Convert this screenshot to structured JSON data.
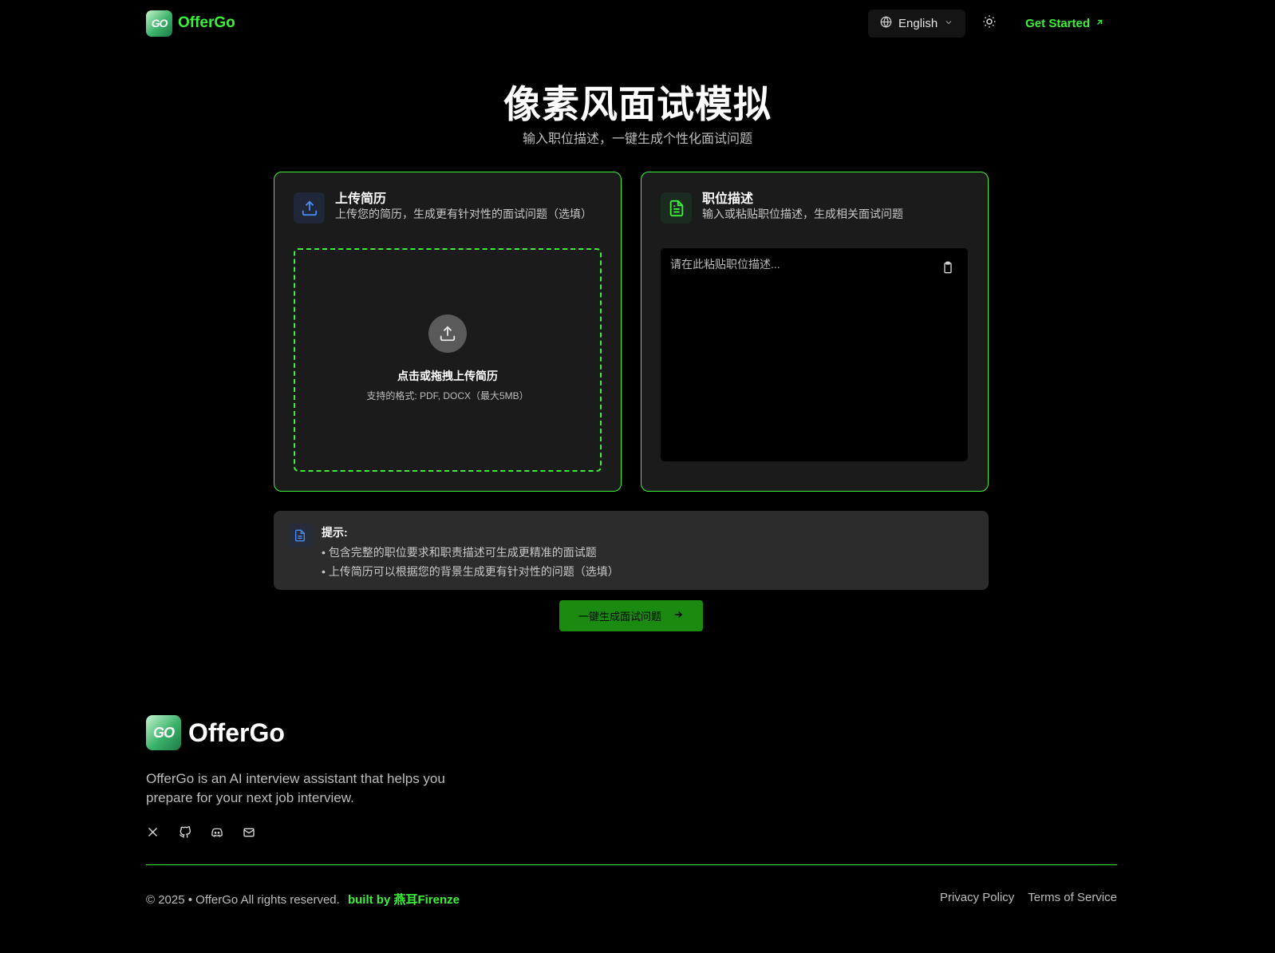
{
  "header": {
    "logo_text": "GO",
    "brand": "OfferGo",
    "language": "English",
    "cta": "Get Started"
  },
  "hero": {
    "title": "像素风面试模拟",
    "subtitle": "输入职位描述，一键生成个性化面试问题"
  },
  "resume_card": {
    "title": "上传简历",
    "description": "上传您的简历，生成更有针对性的面试问题（选填）",
    "upload_title": "点击或拖拽上传简历",
    "upload_hint": "支持的格式: PDF, DOCX（最大5MB）"
  },
  "job_card": {
    "title": "职位描述",
    "description": "输入或粘贴职位描述，生成相关面试问题",
    "placeholder": "请在此粘贴职位描述...",
    "value": ""
  },
  "tips": {
    "title": "提示:",
    "items": [
      "• 包含完整的职位要求和职责描述可生成更精准的面试题",
      "• 上传简历可以根据您的背景生成更有针对性的问题（选填）"
    ]
  },
  "generate_button": "一键生成面试问题",
  "footer": {
    "logo_text": "GO",
    "brand": "OfferGo",
    "description": "OfferGo is an AI interview assistant that helps you prepare for your next job interview.",
    "copyright": "© 2025 • OfferGo All rights reserved.",
    "built_by": "built by 燕耳Firenze",
    "links": [
      "Privacy Policy",
      "Terms of Service"
    ],
    "socials": [
      "x-icon",
      "github-icon",
      "discord-icon",
      "mail-icon"
    ]
  },
  "colors": {
    "accent": "#3df03a",
    "button": "#1a8a10",
    "card_bg": "#1b1b1b",
    "tips_bg": "#2c2c2c",
    "background": "#000000"
  }
}
